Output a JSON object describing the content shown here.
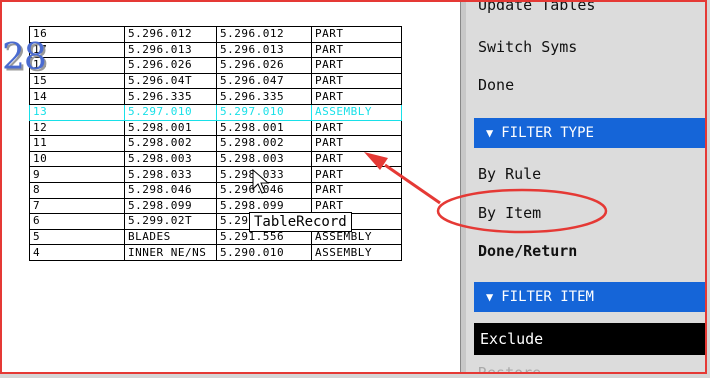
{
  "sheet": {
    "number": "28"
  },
  "table": {
    "rows": [
      [
        "16",
        "5.296.012",
        "5.296.012",
        "PART"
      ],
      [
        "17",
        "5.296.013",
        "5.296.013",
        "PART"
      ],
      [
        "16",
        "5.296.026",
        "5.296.026",
        "PART"
      ],
      [
        "15",
        "5.296.04T",
        "5.296.047",
        "PART"
      ],
      [
        "14",
        "5.296.335",
        "5.296.335",
        "PART"
      ],
      [
        "13",
        "5.297.010",
        "5.297.010",
        "ASSEMBLY"
      ],
      [
        "12",
        "5.298.001",
        "5.298.001",
        "PART"
      ],
      [
        "11",
        "5.298.002",
        "5.298.002",
        "PART"
      ],
      [
        "10",
        "5.298.003",
        "5.298.003",
        "PART"
      ],
      [
        "9",
        "5.298.033",
        "5.298.033",
        "PART"
      ],
      [
        "8",
        "5.298.046",
        "5.296.046",
        "PART"
      ],
      [
        "7",
        "5.298.099",
        "5.298.099",
        "PART"
      ],
      [
        "6",
        "5.299.02T",
        "5.299.027",
        "PART"
      ],
      [
        "5",
        "BLADES",
        "5.291.556",
        "ASSEMBLY"
      ],
      [
        "4",
        "INNER NE/NS",
        "5.290.010",
        "ASSEMBLY"
      ]
    ],
    "highlight_row": 5,
    "highlight_color": "#18e0e8"
  },
  "tooltip": {
    "text": "TableRecord"
  },
  "menu": {
    "update_tables": "Update Tables",
    "switch_syms": "Switch Syms",
    "done": "Done",
    "filter_type_header": "FILTER TYPE",
    "by_rule": "By Rule",
    "by_item": "By Item",
    "done_return": "Done/Return",
    "filter_item_header": "FILTER ITEM",
    "exclude": "Exclude",
    "restore": "Restore"
  },
  "colors": {
    "header_blue": "#1565d8",
    "annotation_red": "#e53935",
    "selected_bg": "#000000"
  }
}
